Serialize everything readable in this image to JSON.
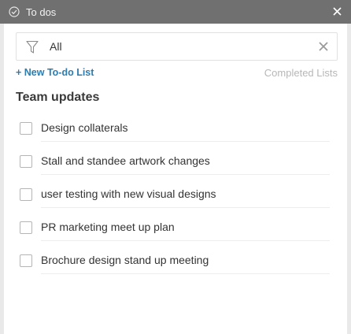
{
  "window": {
    "title": "To dos",
    "app_icon": "checkmark-circle-icon",
    "close_icon": "close-icon"
  },
  "filter": {
    "value": "All",
    "icon": "funnel-icon",
    "clear_icon": "close-icon"
  },
  "actions": {
    "new_list_label": "+ New To-do List",
    "completed_lists_label": "Completed Lists"
  },
  "list": {
    "title": "Team updates",
    "items": [
      {
        "label": "Design collaterals",
        "checked": false
      },
      {
        "label": "Stall and standee artwork changes",
        "checked": false
      },
      {
        "label": "user testing with new visual designs",
        "checked": false
      },
      {
        "label": "PR marketing meet up plan",
        "checked": false
      },
      {
        "label": "Brochure design stand up meeting",
        "checked": false
      }
    ]
  },
  "colors": {
    "titlebar": "#707070",
    "accent": "#2e7db0",
    "muted": "#b7b7b7",
    "background": "#e9e9e9"
  }
}
